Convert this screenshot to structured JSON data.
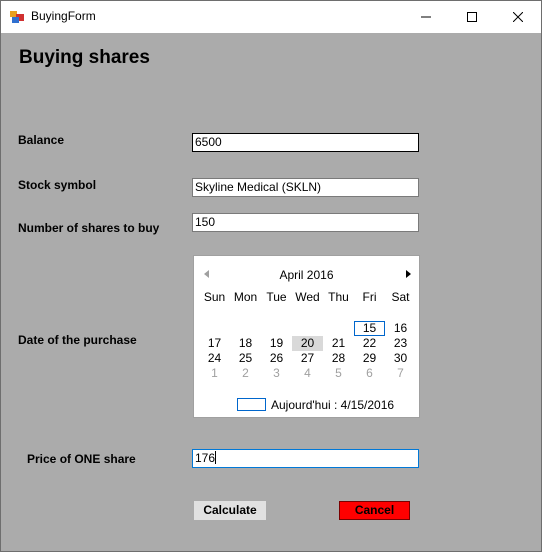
{
  "window": {
    "title": "BuyingForm",
    "icon": "form-app-icon",
    "controls": [
      "minimize-icon",
      "maximize-icon",
      "close-icon"
    ]
  },
  "form": {
    "heading": "Buying shares",
    "balance": {
      "label": "Balance",
      "value": "6500"
    },
    "symbol": {
      "label": "Stock symbol",
      "value": "Skyline Medical (SKLN)"
    },
    "shares": {
      "label": "Number of shares to buy",
      "value": "150"
    },
    "date": {
      "label": "Date of the purchase"
    },
    "price": {
      "label": "Price of ONE share",
      "value": "176"
    }
  },
  "calendar": {
    "month": "April 2016",
    "weekdays": [
      "Sun",
      "Mon",
      "Tue",
      "Wed",
      "Thu",
      "Fri",
      "Sat"
    ],
    "rows": [
      [
        "",
        "",
        "",
        "",
        "",
        "15",
        "16"
      ],
      [
        "17",
        "18",
        "19",
        "20",
        "21",
        "22",
        "23"
      ],
      [
        "24",
        "25",
        "26",
        "27",
        "28",
        "29",
        "30"
      ],
      [
        "1",
        "2",
        "3",
        "4",
        "5",
        "6",
        "7"
      ]
    ],
    "today_label": "Aujourd'hui : 4/15/2016",
    "today_day": "15",
    "selected_day": "20"
  },
  "buttons": {
    "calculate": "Calculate",
    "cancel": "Cancel"
  },
  "colors": {
    "form_bg": "#ababab",
    "cancel_bg": "#ff0000",
    "focus_border": "#0078d7"
  }
}
